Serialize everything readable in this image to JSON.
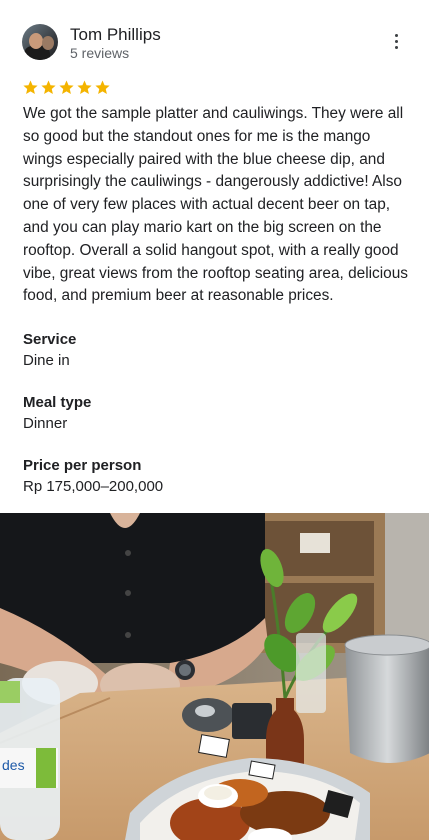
{
  "reviewer": {
    "name": "Tom Phillips",
    "reviews": "5 reviews"
  },
  "rating": 5,
  "review_text": "We got the sample platter and cauliwings. They were all so good but the standout ones for me is the mango wings especially paired with the blue cheese dip, and surprisingly the cauliwings - dangerously addictive! Also one of very few places with actual decent beer on tap, and you can play mario kart on the big screen on the rooftop. Overall a solid hangout spot, with a really good vibe, great views from the rooftop seating area, delicious food, and premium beer at reasonable prices.",
  "details": [
    {
      "label": "Service",
      "value": "Dine in"
    },
    {
      "label": "Meal type",
      "value": "Dinner"
    },
    {
      "label": "Price per person",
      "value": "Rp 175,000–200,000"
    }
  ],
  "colors": {
    "star": "#f4b400",
    "text": "#202124",
    "secondary": "#5f6368"
  },
  "icons": {
    "more": "more-vert-icon",
    "star": "star-icon"
  }
}
